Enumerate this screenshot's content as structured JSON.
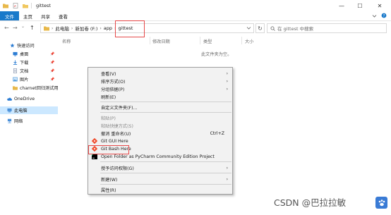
{
  "window": {
    "title": "gittest"
  },
  "titlebar_icons": [
    "folder-icon",
    "properties-icon",
    "new-folder-icon"
  ],
  "window_controls": {
    "minimize": "—",
    "maximize": "☐",
    "close": "✕"
  },
  "ribbon": {
    "tabs": [
      {
        "label": "文件",
        "active": true
      },
      {
        "label": "主页"
      },
      {
        "label": "共享"
      },
      {
        "label": "查看"
      }
    ],
    "expand_icon": "chevron-down-icon",
    "help_icon": "help-icon"
  },
  "nav": {
    "back": "←",
    "forward": "→",
    "recent": "⌄",
    "up": "↑",
    "breadcrumbs": [
      "此电脑",
      "新加卷 (F:)",
      "app",
      "gittest"
    ],
    "refresh": "↻",
    "search_placeholder": "在 gittest 中搜索"
  },
  "sidebar": {
    "items": [
      {
        "label": "快速访问",
        "icon": "star-icon",
        "color": "#2b7cd3"
      },
      {
        "label": "桌面",
        "icon": "desktop-icon",
        "color": "#2b7cd3",
        "pinned": true
      },
      {
        "label": "下载",
        "icon": "download-icon",
        "color": "#2b7cd3",
        "pinned": true
      },
      {
        "label": "文档",
        "icon": "documents-icon",
        "color": "#7a8aa6",
        "pinned": true
      },
      {
        "label": "图片",
        "icon": "pictures-icon",
        "color": "#3d8fd6",
        "pinned": true
      },
      {
        "label": "charnet回归测试用",
        "icon": "folder-icon",
        "color": "#e8b84a"
      },
      {
        "label": "OneDrive",
        "icon": "cloud-icon",
        "color": "#2b7cd3"
      },
      {
        "label": "此电脑",
        "icon": "computer-icon",
        "color": "#4a90d9",
        "selected": true
      },
      {
        "label": "网络",
        "icon": "network-icon",
        "color": "#4a90d9"
      }
    ]
  },
  "columns": [
    "名称",
    "修改日期",
    "类型",
    "大小"
  ],
  "empty_message": "此文件夹为空。",
  "context_menu": {
    "items": [
      {
        "label": "查看(V)",
        "submenu": true
      },
      {
        "label": "排序方式(O)",
        "submenu": true
      },
      {
        "label": "分组依据(P)",
        "submenu": true
      },
      {
        "label": "刷新(E)"
      },
      {
        "separator": true
      },
      {
        "label": "自定义文件夹(F)..."
      },
      {
        "separator": true
      },
      {
        "label": "粘贴(P)",
        "disabled": true
      },
      {
        "label": "粘贴快捷方式(S)",
        "disabled": true
      },
      {
        "label": "撤消 重命名(U)",
        "shortcut": "Ctrl+Z"
      },
      {
        "label": "Git GUI Here",
        "icon": "git-gui-icon"
      },
      {
        "label": "Git Bash Here",
        "icon": "git-bash-icon",
        "highlighted_box": true
      },
      {
        "label": "Open Folder as PyCharm Community Edition Project",
        "icon": "pycharm-icon"
      },
      {
        "separator": true
      },
      {
        "label": "授予访问权限(G)",
        "submenu": true
      },
      {
        "separator": true
      },
      {
        "label": "新建(W)",
        "submenu": true
      },
      {
        "separator": true
      },
      {
        "label": "属性(R)"
      }
    ]
  },
  "watermark": {
    "text": "CSDN @巴拉拉敏",
    "logo": "paw-icon"
  },
  "colors": {
    "accent": "#1979ca",
    "highlight_box": "#e54848",
    "selected_bg": "#cce8ff"
  }
}
